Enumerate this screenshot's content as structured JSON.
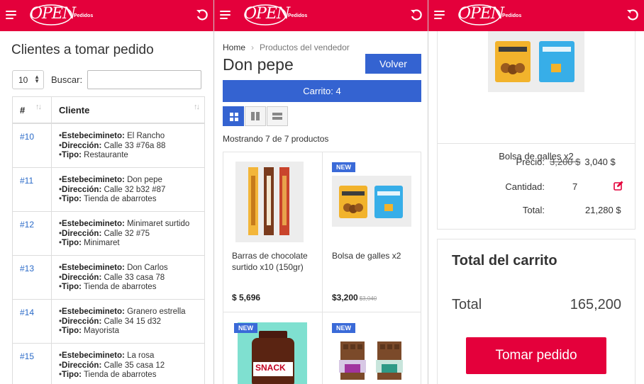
{
  "brand": {
    "logo_text": "OPEN",
    "logo_sub": "Pedidos",
    "color": "#e4003b"
  },
  "panel1": {
    "title": "Clientes a tomar pedido",
    "page_length": "10",
    "search_label": "Buscar:",
    "search_value": "",
    "columns": [
      "#",
      "Cliente"
    ],
    "labels": {
      "est": "Estebecimineto:",
      "dir": "Dirección:",
      "tipo": "Tipo:"
    },
    "rows": [
      {
        "id": "#10",
        "est": "El Rancho",
        "dir": "Calle 33 #76a 88",
        "tipo": "Restaurante"
      },
      {
        "id": "#11",
        "est": "Don pepe",
        "dir": "Calle 32 b32 #87",
        "tipo": "Tienda de abarrotes"
      },
      {
        "id": "#12",
        "est": "Minimaret surtido",
        "dir": "Calle 32 #75",
        "tipo": "Minimaret"
      },
      {
        "id": "#13",
        "est": "Don Carlos",
        "dir": "Calle 33 casa 78",
        "tipo": "Tienda de abarrotes"
      },
      {
        "id": "#14",
        "est": "Granero estrella",
        "dir": "Calle 34 15 d32",
        "tipo": "Mayorista"
      },
      {
        "id": "#15",
        "est": "La rosa",
        "dir": "Calle 35 casa 12",
        "tipo": "Tienda de abarrotes"
      }
    ]
  },
  "panel2": {
    "breadcrumb": {
      "home": "Home",
      "current": "Productos del vendedor"
    },
    "title": "Don pepe",
    "back_label": "Volver",
    "cart_label": "Carrito: 4",
    "showing": "Mostrando 7 de 7 productos",
    "badge": "NEW",
    "products": [
      {
        "name": "Barras de chocolate surtido x10 (150gr)",
        "price": "$ 5,696",
        "old": ""
      },
      {
        "name": "Bolsa de galles x2",
        "price": "$3,200",
        "old": "$3,040"
      },
      {
        "name": "",
        "price": "",
        "old": "",
        "image_text": "SNACK"
      },
      {
        "name": "",
        "price": "",
        "old": ""
      }
    ]
  },
  "panel3": {
    "product_name": "Bolsa de galles x2",
    "price_label": "Precio:",
    "price_old": "3,200 $",
    "price_new": "3,040 $",
    "qty_label": "Cantidad:",
    "qty": "7",
    "total_label": "Total:",
    "total": "21,280 $",
    "cart_title": "Total del carrito",
    "cart_total_label": "Total",
    "cart_total": "165,200",
    "take_order": "Tomar pedido"
  }
}
